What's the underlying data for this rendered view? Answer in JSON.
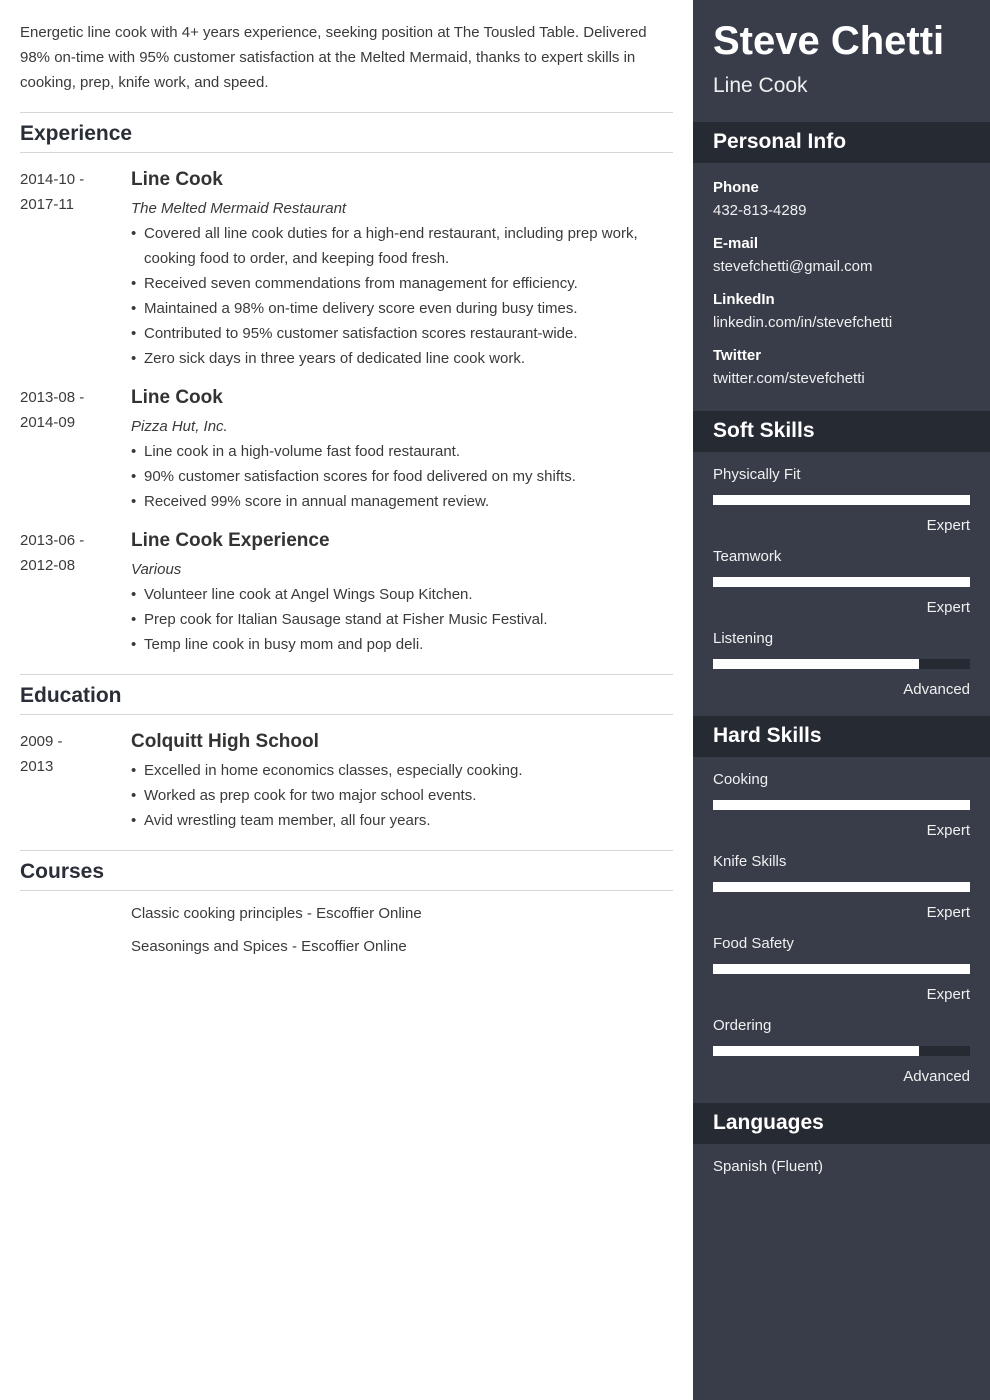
{
  "summary": "Energetic line cook with 4+ years experience, seeking position at The Tousled Table. Delivered 98% on-time with 95% customer satisfaction at the Melted Mermaid, thanks to expert skills in cooking, prep, knife work, and speed.",
  "sections": {
    "experience": "Experience",
    "education": "Education",
    "courses": "Courses"
  },
  "experience": [
    {
      "date_start": "2014-10 -",
      "date_end": "2017-11",
      "title": "Line Cook",
      "org": "The Melted Mermaid Restaurant",
      "bullets": [
        "Covered all line cook duties for a high-end restaurant, including prep work, cooking food to order, and keeping food fresh.",
        "Received seven commendations from management for efficiency.",
        "Maintained a 98% on-time delivery score even during busy times.",
        "Contributed to 95% customer satisfaction scores restaurant-wide.",
        "Zero sick days in three years of dedicated line cook work."
      ]
    },
    {
      "date_start": "2013-08 -",
      "date_end": "2014-09",
      "title": "Line Cook",
      "org": "Pizza Hut, Inc.",
      "bullets": [
        "Line cook in a high-volume fast food restaurant.",
        "90% customer satisfaction scores for food delivered on my shifts.",
        "Received 99% score in annual management review."
      ]
    },
    {
      "date_start": "2013-06 -",
      "date_end": "2012-08",
      "title": "Line Cook Experience",
      "org": "Various",
      "bullets": [
        "Volunteer line cook at Angel Wings Soup Kitchen.",
        "Prep cook for Italian Sausage stand at Fisher Music Festival.",
        "Temp line cook in busy mom and pop deli."
      ]
    }
  ],
  "education": [
    {
      "date_start": "2009 -",
      "date_end": "2013",
      "title": "Colquitt High School",
      "bullets": [
        "Excelled in home economics classes, especially cooking.",
        "Worked as prep cook for two major school events.",
        "Avid wrestling team member, all four years."
      ]
    }
  ],
  "courses": [
    "Classic cooking principles - Escoffier Online",
    "Seasonings and Spices - Escoffier Online"
  ],
  "sidebar": {
    "name": "Steve Chetti",
    "role": "Line Cook",
    "personal_info_title": "Personal Info",
    "personal_info": [
      {
        "label": "Phone",
        "value": "432-813-4289"
      },
      {
        "label": "E-mail",
        "value": "stevefchetti@gmail.com"
      },
      {
        "label": "LinkedIn",
        "value": "linkedin.com/in/stevefchetti"
      },
      {
        "label": "Twitter",
        "value": "twitter.com/stevefchetti"
      }
    ],
    "soft_skills_title": "Soft Skills",
    "soft_skills": [
      {
        "name": "Physically Fit",
        "level": "Expert",
        "fraction": 1.0
      },
      {
        "name": "Teamwork",
        "level": "Expert",
        "fraction": 1.0
      },
      {
        "name": "Listening",
        "level": "Advanced",
        "fraction": 0.8
      }
    ],
    "hard_skills_title": "Hard Skills",
    "hard_skills": [
      {
        "name": "Cooking",
        "level": "Expert",
        "fraction": 1.0
      },
      {
        "name": "Knife Skills",
        "level": "Expert",
        "fraction": 1.0
      },
      {
        "name": "Food Safety",
        "level": "Expert",
        "fraction": 1.0
      },
      {
        "name": "Ordering",
        "level": "Advanced",
        "fraction": 0.8
      }
    ],
    "languages_title": "Languages",
    "languages": [
      "Spanish (Fluent)"
    ]
  },
  "colors": {
    "sidebar_bg": "#383d49",
    "sidebar_header_bg": "#262a33",
    "bar_fill": "#ffffff",
    "heading_text": "#2a2e36"
  }
}
